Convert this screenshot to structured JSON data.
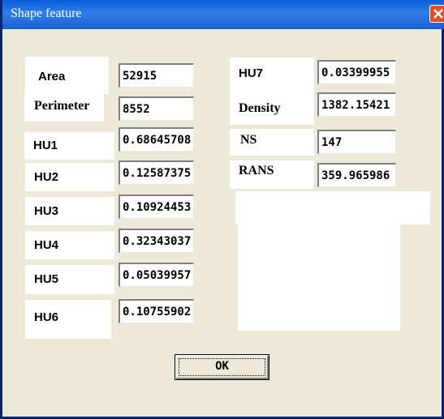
{
  "window": {
    "title": "Shape feature"
  },
  "left_fields": [
    {
      "label": "Area",
      "value": "52915"
    },
    {
      "label": "Perimeter",
      "value": "8552"
    },
    {
      "label": "HU1",
      "value": "0.68645708"
    },
    {
      "label": "HU2",
      "value": "0.12587375"
    },
    {
      "label": "HU3",
      "value": "0.10924453"
    },
    {
      "label": "HU4",
      "value": "0.32343037"
    },
    {
      "label": "HU5",
      "value": "0.05039957"
    },
    {
      "label": "HU6",
      "value": "0.10755902"
    }
  ],
  "right_fields": [
    {
      "label": "HU7",
      "value": "0.03399955"
    },
    {
      "label": "Density",
      "value": "1382.15421"
    },
    {
      "label": "NS",
      "value": "147"
    },
    {
      "label": "RANS",
      "value": "359.965986"
    }
  ],
  "buttons": {
    "ok": "OK"
  },
  "icons": {
    "close": "close-icon"
  },
  "colors": {
    "titlebar": "#0a5fd8",
    "close": "#d9522c",
    "dialog": "#ece9d8"
  }
}
